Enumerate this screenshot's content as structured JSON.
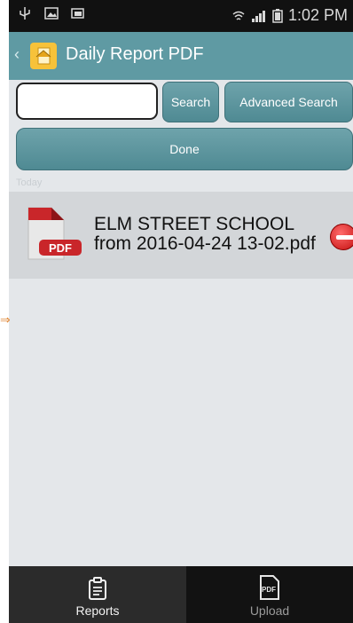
{
  "status_bar": {
    "time": "1:02 PM"
  },
  "header": {
    "title": "Daily Report PDF",
    "back_icon": "chevron-left-icon"
  },
  "search": {
    "value": "",
    "placeholder": "",
    "search_label": "Search",
    "advanced_label": "Advanced Search"
  },
  "done_label": "Done",
  "section_label": "Today",
  "files": [
    {
      "name_line1": "ELM STREET SCHOOL",
      "name_line2": "from 2016-04-24 13-02.pdf",
      "icon_label": "PDF",
      "icon": "pdf-file-icon"
    }
  ],
  "tabs": [
    {
      "label": "Reports",
      "icon": "clipboard-icon"
    },
    {
      "label": "Upload",
      "icon": "pdf-icon",
      "icon_text": "PDF"
    }
  ],
  "colors": {
    "actionbar": "#5f9aa3",
    "delete": "#c41010",
    "pdf_red": "#c9262a"
  }
}
